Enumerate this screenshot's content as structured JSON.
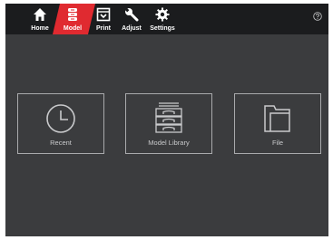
{
  "nav": {
    "items": [
      {
        "label": "Home",
        "icon": "home-icon"
      },
      {
        "label": "Model",
        "icon": "model-stack-icon",
        "active": true
      },
      {
        "label": "Print",
        "icon": "print-icon"
      },
      {
        "label": "Adjust",
        "icon": "wrench-icon"
      },
      {
        "label": "Settings",
        "icon": "gear-icon"
      }
    ],
    "help_icon": "help-icon"
  },
  "tiles": [
    {
      "label": "Recent",
      "icon": "clock-icon"
    },
    {
      "label": "Model Library",
      "icon": "drawers-icon"
    },
    {
      "label": "File",
      "icon": "folder-icon"
    }
  ],
  "colors": {
    "topbar": "#1b1c1e",
    "background": "#3b3c3e",
    "accent": "#e02a30",
    "tile_border": "#a9aaac",
    "tile_text": "#c9cacc"
  }
}
